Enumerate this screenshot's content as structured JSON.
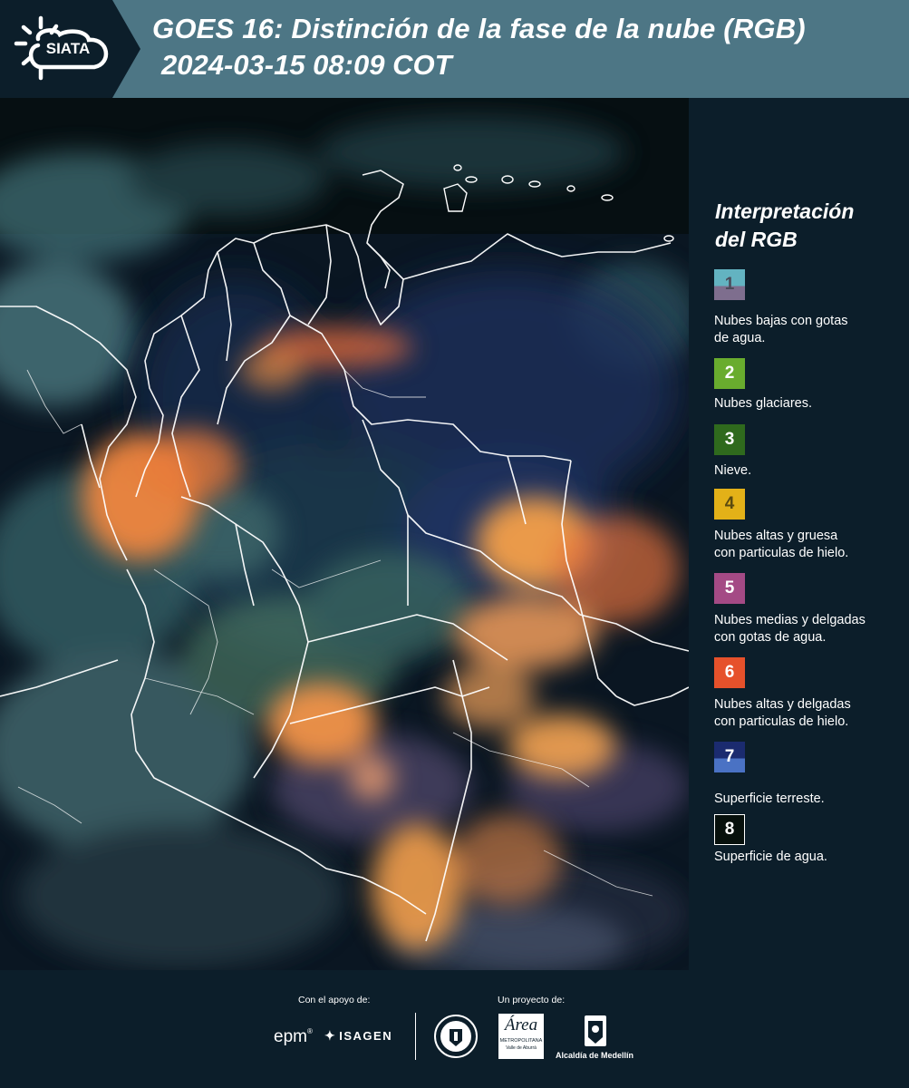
{
  "header": {
    "logo_text": "SIATA",
    "title_line1": "GOES 16: Distinción de la fase de la nube (RGB)",
    "title_line2": "2024-03-15 08:09 COT"
  },
  "legend": {
    "title_line1": "Interpretación",
    "title_line2": "del RGB",
    "items": [
      {
        "number": "1",
        "label_line1": "Nubes bajas con gotas",
        "label_line2": "de agua.",
        "color_top": "#63b3c1",
        "color_bottom": "#7e6e8e",
        "text_color": "#4b4b5a"
      },
      {
        "number": "2",
        "label_line1": "Nubes glaciares.",
        "label_line2": "",
        "color_top": "#69ac2e",
        "color_bottom": "#69ac2e",
        "text_color": "#ffffff"
      },
      {
        "number": "3",
        "label_line1": "Nieve.",
        "label_line2": "",
        "color_top": "#2f6a1d",
        "color_bottom": "#2f6a1d",
        "text_color": "#ffffff"
      },
      {
        "number": "4",
        "label_line1": "Nubes altas y gruesa",
        "label_line2": "con particulas de hielo.",
        "color_top": "#e3b118",
        "color_bottom": "#e3b118",
        "text_color": "#5a4a10"
      },
      {
        "number": "5",
        "label_line1": "Nubes medias y delgadas",
        "label_line2": "con gotas de agua.",
        "color_top": "#a44a85",
        "color_bottom": "#a44a85",
        "text_color": "#ffffff"
      },
      {
        "number": "6",
        "label_line1": "Nubes altas y delgadas",
        "label_line2": "con particulas de hielo.",
        "color_top": "#e6512b",
        "color_bottom": "#e6512b",
        "text_color": "#ffffff"
      },
      {
        "number": "7",
        "label_line1": "Superficie terreste.",
        "label_line2": "",
        "color_top": "#1b2b6f",
        "color_bottom": "#4a72c4",
        "text_color": "#ffffff"
      },
      {
        "number": "8",
        "label_line1": "Superficie de agua.",
        "label_line2": "",
        "color_top": "#07100c",
        "color_bottom": "#07100c",
        "text_color": "#ffffff"
      }
    ]
  },
  "footer": {
    "support_label": "Con el apoyo de:",
    "project_label": "Un proyecto de:",
    "epm_logo": "epm",
    "isagen_logo": "ISAGEN",
    "area_logo_main": "Área",
    "area_logo_sub1": "METROPOLITANA",
    "area_logo_sub2": "Valle de Aburrá",
    "alcaldia_logo": "Alcaldía de Medellín"
  },
  "colors": {
    "header_bg": "#4d7685",
    "logo_bg": "#0c1e2a",
    "page_bg": "#0c1e2a",
    "cloud_orange": "#f39a4e",
    "ocean": "#0a1622",
    "land": "#1b3350"
  },
  "icons": [
    "sun-cloud-logo-icon",
    "epm-logo-icon",
    "isagen-logo-icon",
    "municipio-seal-icon",
    "area-metropolitana-logo-icon",
    "alcaldia-seal-icon"
  ]
}
